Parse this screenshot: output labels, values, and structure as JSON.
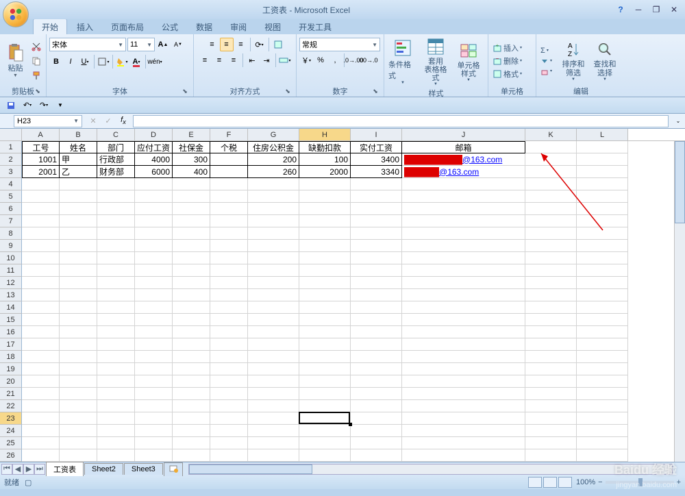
{
  "title": "工资表 - Microsoft Excel",
  "tabs": [
    "开始",
    "插入",
    "页面布局",
    "公式",
    "数据",
    "审阅",
    "视图",
    "开发工具"
  ],
  "active_tab": 0,
  "clipboard": {
    "paste": "粘贴",
    "label": "剪贴板"
  },
  "font": {
    "name": "宋体",
    "size": "11",
    "label": "字体",
    "grow": "A",
    "shrink": "A"
  },
  "align": {
    "label": "对齐方式"
  },
  "number": {
    "format": "常规",
    "label": "数字"
  },
  "styles": {
    "cond": "条件格式",
    "table": "套用\n表格格式",
    "cell": "单元格\n样式",
    "label": "样式"
  },
  "cells": {
    "insert": "插入",
    "delete": "删除",
    "format": "格式",
    "label": "单元格"
  },
  "editing": {
    "sort": "排序和\n筛选",
    "find": "查找和\n选择",
    "label": "编辑"
  },
  "namebox": "H23",
  "columns": [
    {
      "l": "A",
      "w": 55
    },
    {
      "l": "B",
      "w": 55
    },
    {
      "l": "C",
      "w": 55
    },
    {
      "l": "D",
      "w": 55
    },
    {
      "l": "E",
      "w": 55
    },
    {
      "l": "F",
      "w": 55
    },
    {
      "l": "G",
      "w": 75
    },
    {
      "l": "H",
      "w": 75
    },
    {
      "l": "I",
      "w": 75
    },
    {
      "l": "J",
      "w": 180
    },
    {
      "l": "K",
      "w": 75
    },
    {
      "l": "L",
      "w": 75
    }
  ],
  "headers": [
    "工号",
    "姓名",
    "部门",
    "应付工资",
    "社保金",
    "个税",
    "住房公积金",
    "缺勤扣款",
    "实付工资",
    "邮箱"
  ],
  "data_rows": [
    {
      "id": "1001",
      "name": "甲",
      "dept": "行政部",
      "pay": "4000",
      "sb": "300",
      "tax": "",
      "hf": "200",
      "kk": "100",
      "net": "3400",
      "mail_mask": "██████████",
      "mail_tail": "@163.com"
    },
    {
      "id": "2001",
      "name": "乙",
      "dept": "财务部",
      "pay": "6000",
      "sb": "400",
      "tax": "",
      "hf": "260",
      "kk": "2000",
      "net": "3340",
      "mail_mask": "██████",
      "mail_tail": "@163.com"
    }
  ],
  "selected_col": "H",
  "selected_row": 23,
  "active_cell": "H23",
  "sheets": [
    "工资表",
    "Sheet2",
    "Sheet3"
  ],
  "active_sheet": 0,
  "status_text": "就绪",
  "zoom": "100%",
  "watermark": "Baidu 经验",
  "watermark_url": "jingyan.baidu.com"
}
